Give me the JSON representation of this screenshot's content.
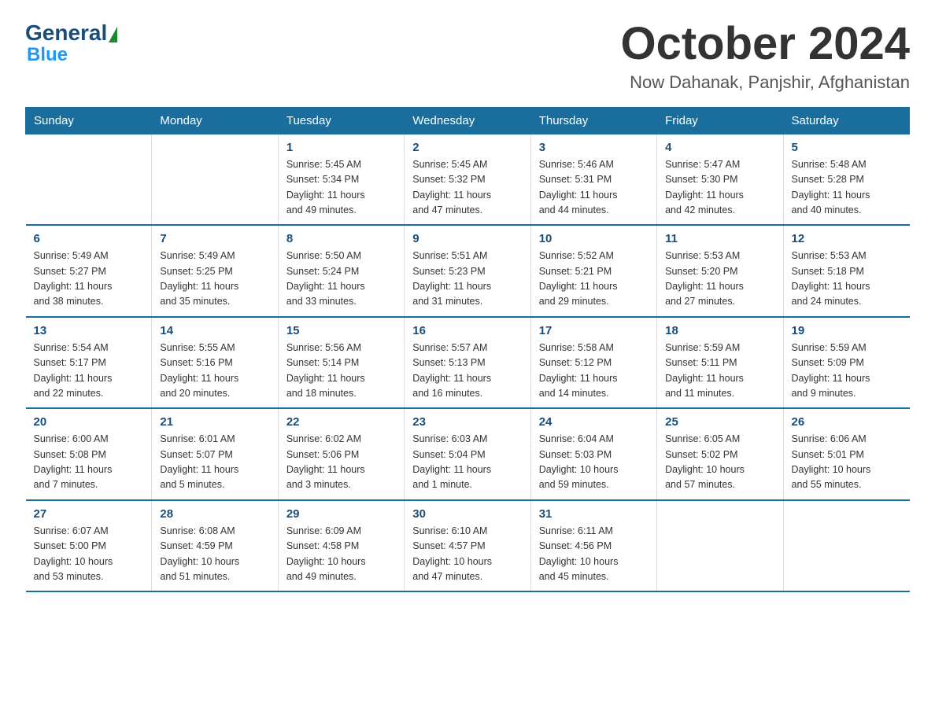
{
  "logo": {
    "general": "General",
    "blue": "Blue"
  },
  "title": "October 2024",
  "location": "Now Dahanak, Panjshir, Afghanistan",
  "days_of_week": [
    "Sunday",
    "Monday",
    "Tuesday",
    "Wednesday",
    "Thursday",
    "Friday",
    "Saturday"
  ],
  "weeks": [
    [
      {
        "day": "",
        "info": ""
      },
      {
        "day": "",
        "info": ""
      },
      {
        "day": "1",
        "info": "Sunrise: 5:45 AM\nSunset: 5:34 PM\nDaylight: 11 hours\nand 49 minutes."
      },
      {
        "day": "2",
        "info": "Sunrise: 5:45 AM\nSunset: 5:32 PM\nDaylight: 11 hours\nand 47 minutes."
      },
      {
        "day": "3",
        "info": "Sunrise: 5:46 AM\nSunset: 5:31 PM\nDaylight: 11 hours\nand 44 minutes."
      },
      {
        "day": "4",
        "info": "Sunrise: 5:47 AM\nSunset: 5:30 PM\nDaylight: 11 hours\nand 42 minutes."
      },
      {
        "day": "5",
        "info": "Sunrise: 5:48 AM\nSunset: 5:28 PM\nDaylight: 11 hours\nand 40 minutes."
      }
    ],
    [
      {
        "day": "6",
        "info": "Sunrise: 5:49 AM\nSunset: 5:27 PM\nDaylight: 11 hours\nand 38 minutes."
      },
      {
        "day": "7",
        "info": "Sunrise: 5:49 AM\nSunset: 5:25 PM\nDaylight: 11 hours\nand 35 minutes."
      },
      {
        "day": "8",
        "info": "Sunrise: 5:50 AM\nSunset: 5:24 PM\nDaylight: 11 hours\nand 33 minutes."
      },
      {
        "day": "9",
        "info": "Sunrise: 5:51 AM\nSunset: 5:23 PM\nDaylight: 11 hours\nand 31 minutes."
      },
      {
        "day": "10",
        "info": "Sunrise: 5:52 AM\nSunset: 5:21 PM\nDaylight: 11 hours\nand 29 minutes."
      },
      {
        "day": "11",
        "info": "Sunrise: 5:53 AM\nSunset: 5:20 PM\nDaylight: 11 hours\nand 27 minutes."
      },
      {
        "day": "12",
        "info": "Sunrise: 5:53 AM\nSunset: 5:18 PM\nDaylight: 11 hours\nand 24 minutes."
      }
    ],
    [
      {
        "day": "13",
        "info": "Sunrise: 5:54 AM\nSunset: 5:17 PM\nDaylight: 11 hours\nand 22 minutes."
      },
      {
        "day": "14",
        "info": "Sunrise: 5:55 AM\nSunset: 5:16 PM\nDaylight: 11 hours\nand 20 minutes."
      },
      {
        "day": "15",
        "info": "Sunrise: 5:56 AM\nSunset: 5:14 PM\nDaylight: 11 hours\nand 18 minutes."
      },
      {
        "day": "16",
        "info": "Sunrise: 5:57 AM\nSunset: 5:13 PM\nDaylight: 11 hours\nand 16 minutes."
      },
      {
        "day": "17",
        "info": "Sunrise: 5:58 AM\nSunset: 5:12 PM\nDaylight: 11 hours\nand 14 minutes."
      },
      {
        "day": "18",
        "info": "Sunrise: 5:59 AM\nSunset: 5:11 PM\nDaylight: 11 hours\nand 11 minutes."
      },
      {
        "day": "19",
        "info": "Sunrise: 5:59 AM\nSunset: 5:09 PM\nDaylight: 11 hours\nand 9 minutes."
      }
    ],
    [
      {
        "day": "20",
        "info": "Sunrise: 6:00 AM\nSunset: 5:08 PM\nDaylight: 11 hours\nand 7 minutes."
      },
      {
        "day": "21",
        "info": "Sunrise: 6:01 AM\nSunset: 5:07 PM\nDaylight: 11 hours\nand 5 minutes."
      },
      {
        "day": "22",
        "info": "Sunrise: 6:02 AM\nSunset: 5:06 PM\nDaylight: 11 hours\nand 3 minutes."
      },
      {
        "day": "23",
        "info": "Sunrise: 6:03 AM\nSunset: 5:04 PM\nDaylight: 11 hours\nand 1 minute."
      },
      {
        "day": "24",
        "info": "Sunrise: 6:04 AM\nSunset: 5:03 PM\nDaylight: 10 hours\nand 59 minutes."
      },
      {
        "day": "25",
        "info": "Sunrise: 6:05 AM\nSunset: 5:02 PM\nDaylight: 10 hours\nand 57 minutes."
      },
      {
        "day": "26",
        "info": "Sunrise: 6:06 AM\nSunset: 5:01 PM\nDaylight: 10 hours\nand 55 minutes."
      }
    ],
    [
      {
        "day": "27",
        "info": "Sunrise: 6:07 AM\nSunset: 5:00 PM\nDaylight: 10 hours\nand 53 minutes."
      },
      {
        "day": "28",
        "info": "Sunrise: 6:08 AM\nSunset: 4:59 PM\nDaylight: 10 hours\nand 51 minutes."
      },
      {
        "day": "29",
        "info": "Sunrise: 6:09 AM\nSunset: 4:58 PM\nDaylight: 10 hours\nand 49 minutes."
      },
      {
        "day": "30",
        "info": "Sunrise: 6:10 AM\nSunset: 4:57 PM\nDaylight: 10 hours\nand 47 minutes."
      },
      {
        "day": "31",
        "info": "Sunrise: 6:11 AM\nSunset: 4:56 PM\nDaylight: 10 hours\nand 45 minutes."
      },
      {
        "day": "",
        "info": ""
      },
      {
        "day": "",
        "info": ""
      }
    ]
  ]
}
